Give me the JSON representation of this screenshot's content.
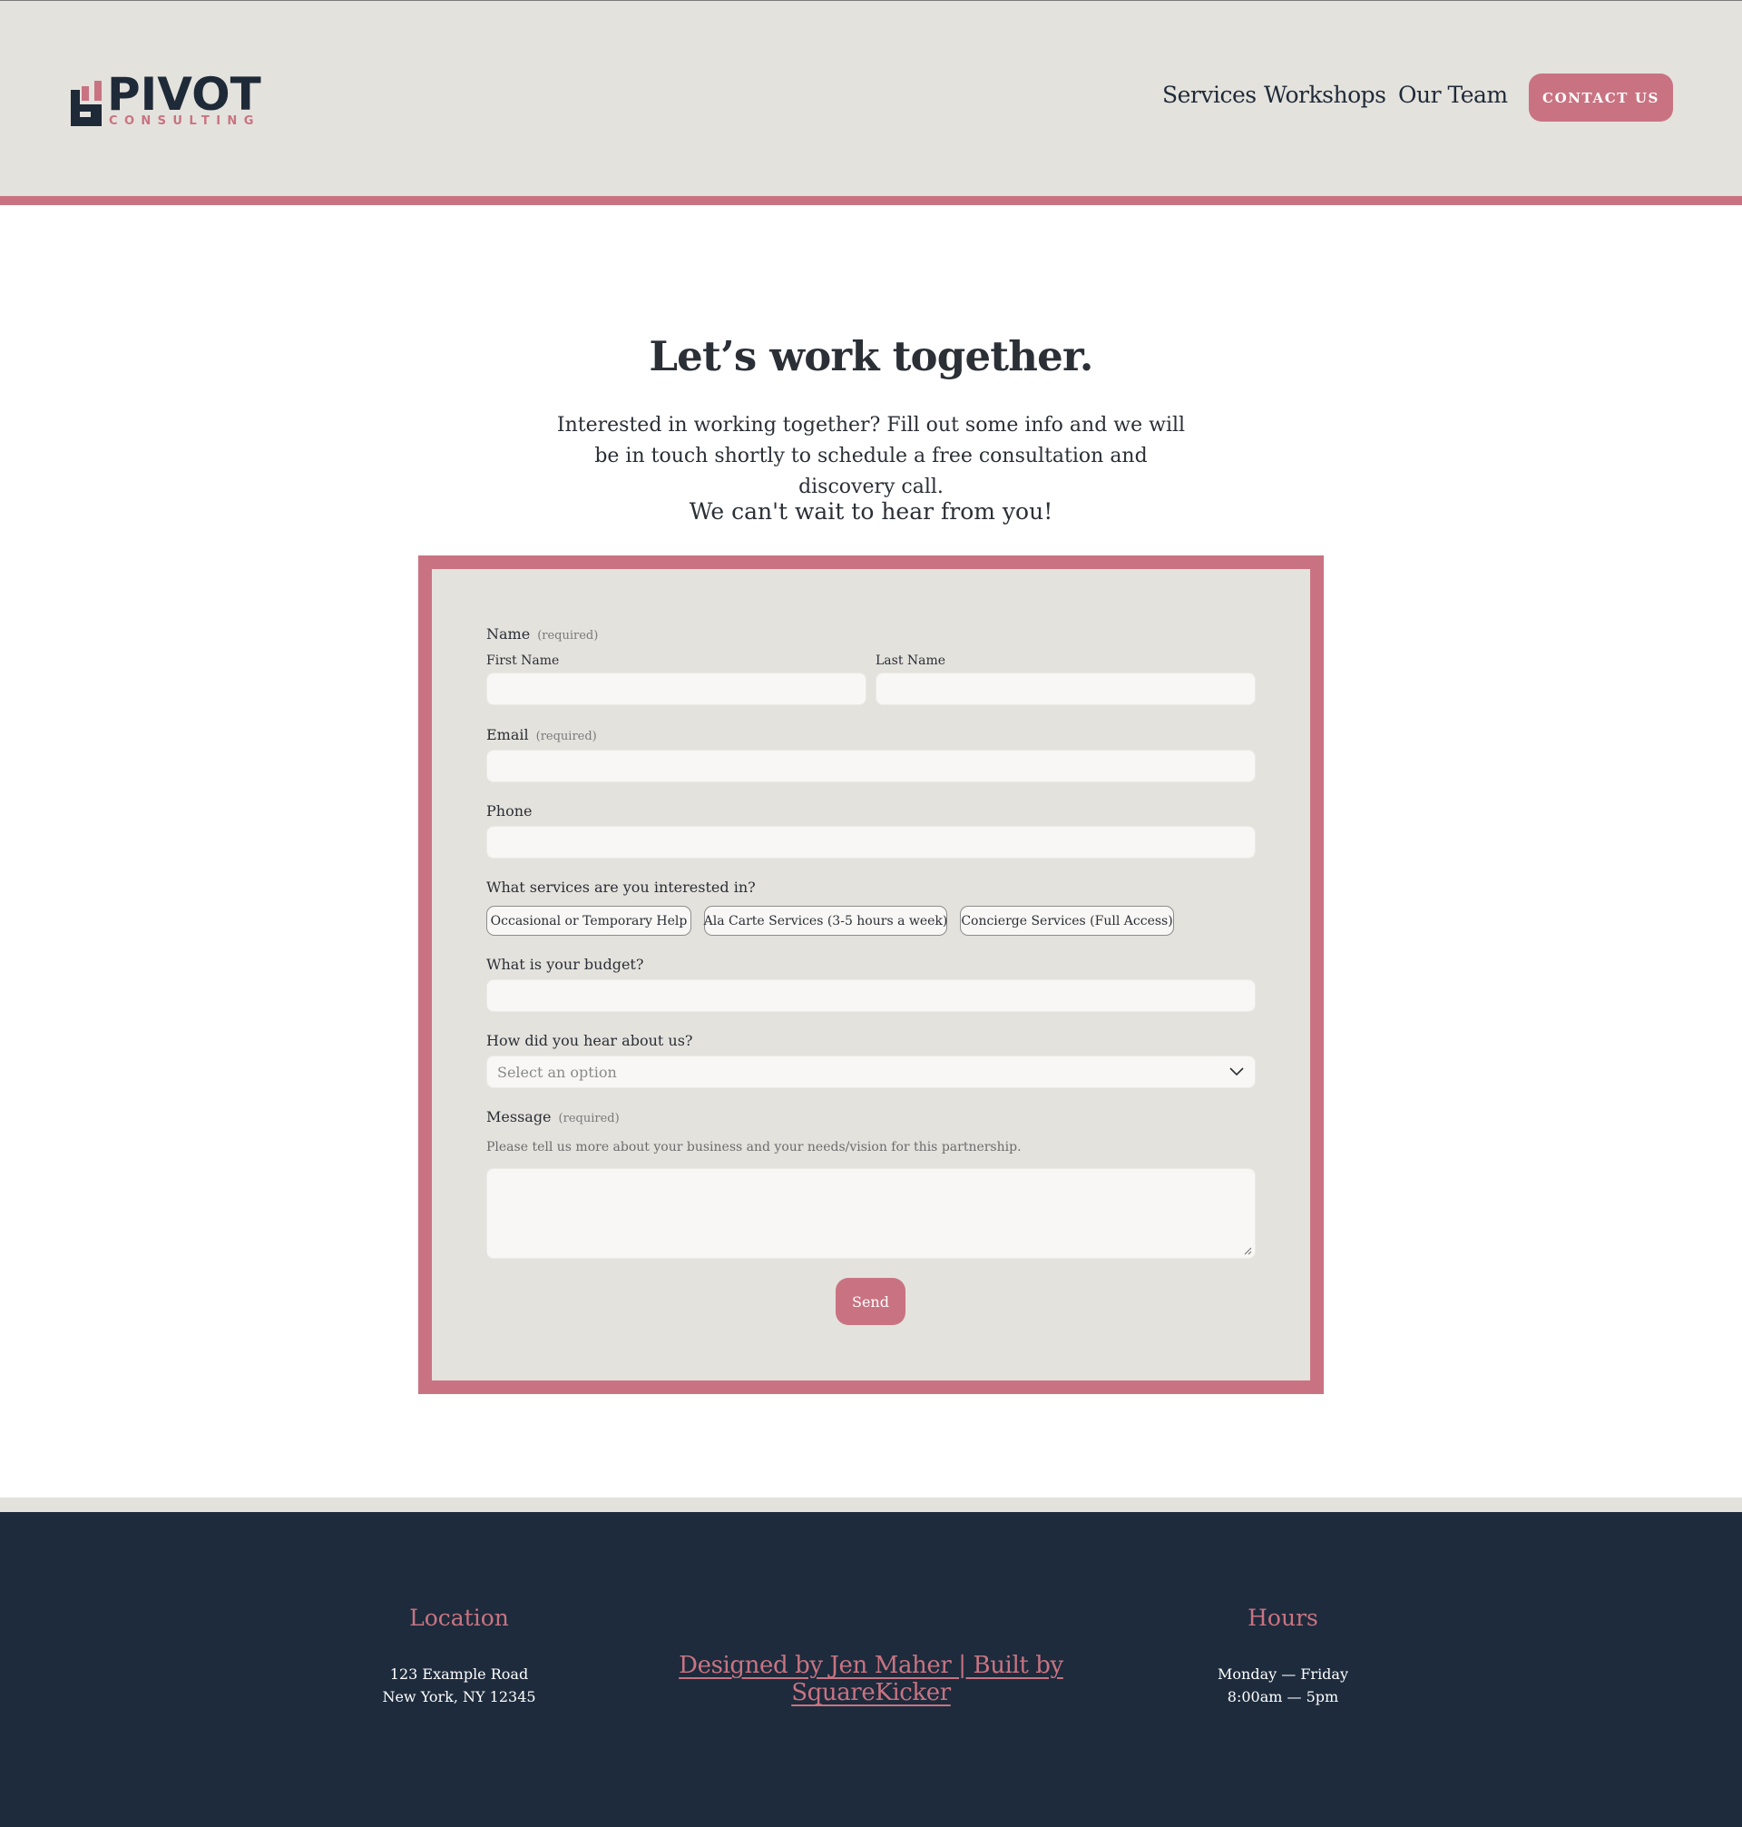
{
  "header": {
    "logo": {
      "word": "PIVOT",
      "sub": "CONSULTING"
    },
    "nav": {
      "services": "Services",
      "workshops": "Workshops",
      "team": "Our Team",
      "contact": "CONTACT US"
    }
  },
  "hero": {
    "title": "Let’s work together.",
    "description": "Interested in working together? Fill out some info and we will be in touch shortly to schedule a free consultation and discovery call.",
    "subtitle": "We can't wait to hear from you!"
  },
  "form": {
    "name_label": "Name",
    "required": "(required)",
    "first_name_label": "First Name",
    "last_name_label": "Last Name",
    "email_label": "Email",
    "phone_label": "Phone",
    "services_label": "What services are you interested in?",
    "services_options": [
      "Occasional or Temporary Help",
      "Ala Carte Services (3-5 hours a week)",
      "Concierge Services (Full Access)"
    ],
    "budget_label": "What is your budget?",
    "hear_label": "How did you hear about us?",
    "hear_placeholder": "Select an option",
    "message_label": "Message",
    "message_help": "Please tell us more about your business and your needs/vision for this partnership.",
    "send_label": "Send"
  },
  "footer": {
    "location_title": "Location",
    "address_line1": "123 Example Road",
    "address_line2": "New York, NY 12345",
    "credit": "Designed by Jen Maher | Built by SquareKicker",
    "hours_title": "Hours",
    "hours_line1": "Monday — Friday",
    "hours_line2": "8:00am — 5pm"
  },
  "colors": {
    "accent": "#c97382",
    "header_bg": "#e4e2dd",
    "navy": "#1d2b3c"
  }
}
